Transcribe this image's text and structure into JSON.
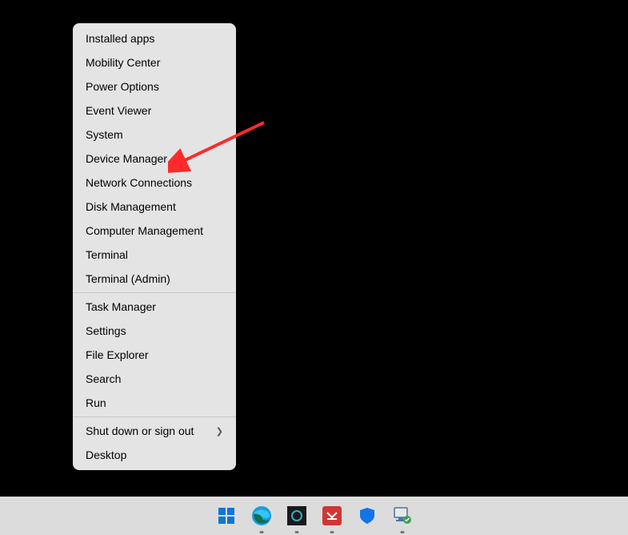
{
  "menu": {
    "items_group1": [
      {
        "label": "Installed apps"
      },
      {
        "label": "Mobility Center"
      },
      {
        "label": "Power Options"
      },
      {
        "label": "Event Viewer"
      },
      {
        "label": "System"
      },
      {
        "label": "Device Manager"
      },
      {
        "label": "Network Connections"
      },
      {
        "label": "Disk Management"
      },
      {
        "label": "Computer Management"
      },
      {
        "label": "Terminal"
      },
      {
        "label": "Terminal (Admin)"
      }
    ],
    "items_group2": [
      {
        "label": "Task Manager"
      },
      {
        "label": "Settings"
      },
      {
        "label": "File Explorer"
      },
      {
        "label": "Search"
      },
      {
        "label": "Run"
      }
    ],
    "items_group3": [
      {
        "label": "Shut down or sign out",
        "has_submenu": true
      },
      {
        "label": "Desktop"
      }
    ]
  },
  "taskbar": {
    "icons": [
      {
        "name": "start"
      },
      {
        "name": "edge"
      },
      {
        "name": "app-dark"
      },
      {
        "name": "app-red"
      },
      {
        "name": "security"
      },
      {
        "name": "device-manager"
      }
    ]
  },
  "annotation": {
    "color": "#ff2a2a",
    "target": "Device Manager"
  }
}
